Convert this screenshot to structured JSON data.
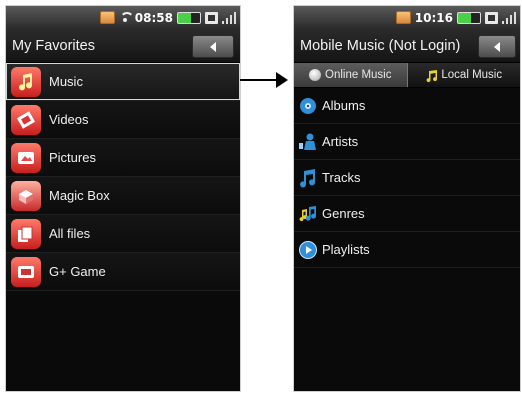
{
  "left_phone": {
    "status": {
      "time": "08:58"
    },
    "title": "My Favorites",
    "items": [
      {
        "label": "Music",
        "icon": "music-note-icon"
      },
      {
        "label": "Videos",
        "icon": "film-icon"
      },
      {
        "label": "Pictures",
        "icon": "pictures-icon"
      },
      {
        "label": "Magic Box",
        "icon": "magic-box-icon"
      },
      {
        "label": "All files",
        "icon": "files-icon"
      },
      {
        "label": "G+ Game",
        "icon": "game-icon"
      }
    ]
  },
  "right_phone": {
    "status": {
      "time": "10:16"
    },
    "title": "Mobile Music (Not Login)",
    "tabs": [
      {
        "label": "Online Music",
        "icon": "globe-icon",
        "active": false
      },
      {
        "label": "Local Music",
        "icon": "music-note-icon",
        "active": true
      }
    ],
    "items": [
      {
        "label": "Albums",
        "icon": "albums-icon"
      },
      {
        "label": "Artists",
        "icon": "artist-icon"
      },
      {
        "label": "Tracks",
        "icon": "tracks-icon"
      },
      {
        "label": "Genres",
        "icon": "genres-icon"
      },
      {
        "label": "Playlists",
        "icon": "playlist-icon"
      }
    ]
  },
  "colors": {
    "app_icon_red": "#c81e1e",
    "accent_yellow": "#e9d02a",
    "list_icon_blue": "#2f8fd9"
  }
}
